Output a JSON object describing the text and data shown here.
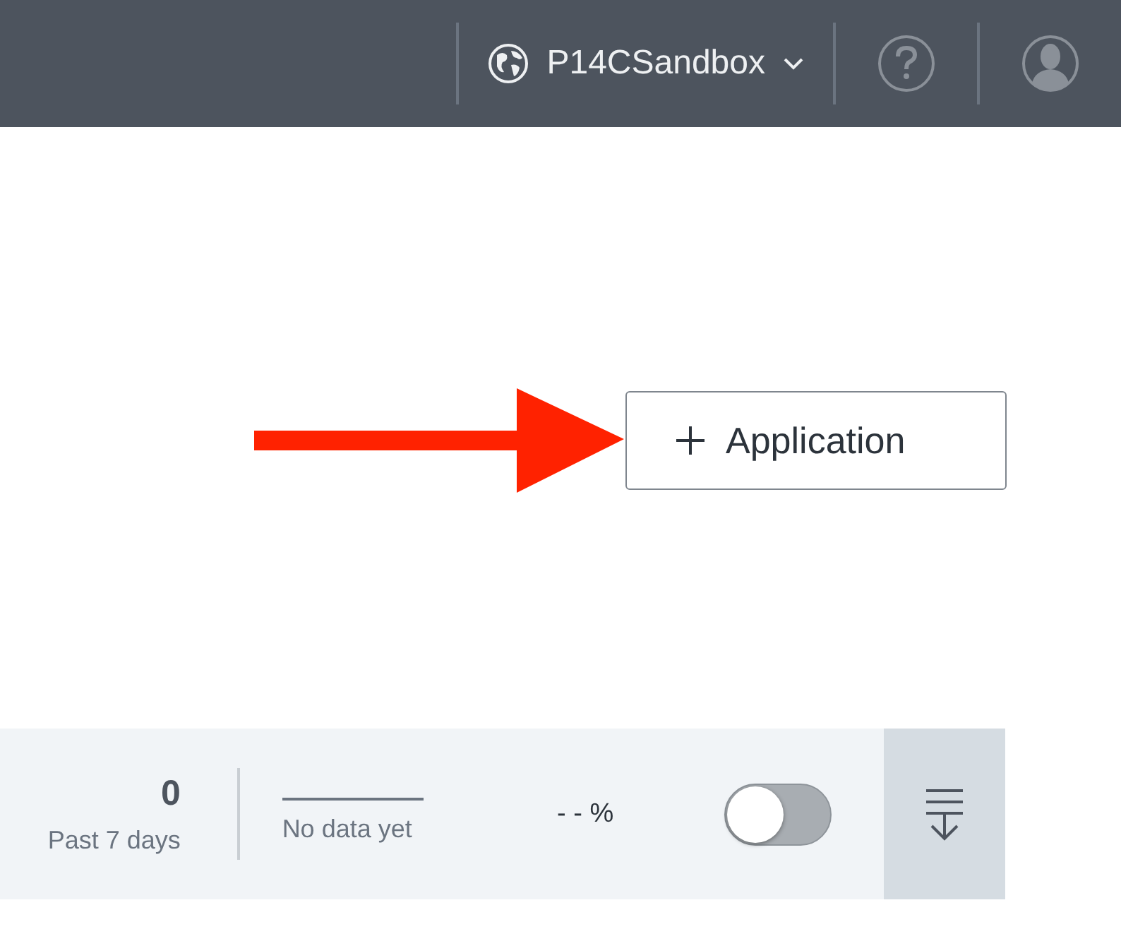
{
  "header": {
    "workspace": "P14CSandbox"
  },
  "add_button": {
    "label": "Application"
  },
  "stats": {
    "count": "0",
    "period": "Past 7 days",
    "trend_label": "No data yet",
    "percent": "- - %",
    "toggle": {
      "on": false
    }
  }
}
